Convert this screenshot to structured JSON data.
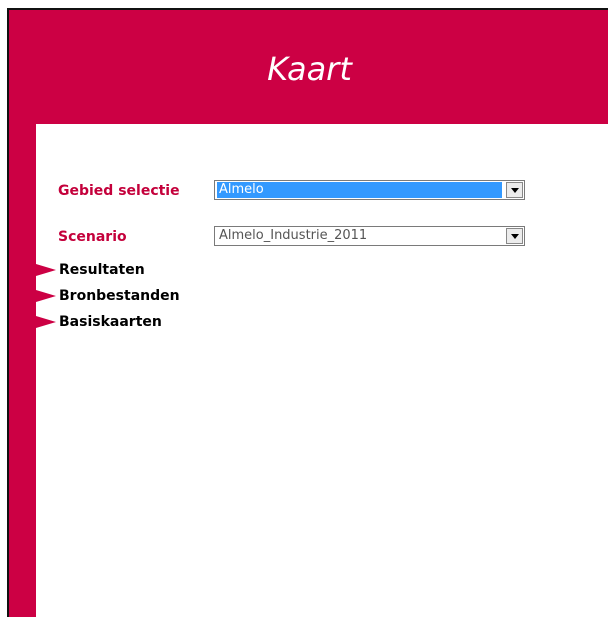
{
  "header": {
    "title": "Kaart"
  },
  "form": {
    "gebied": {
      "label": "Gebied selectie",
      "value": "Almelo"
    },
    "scenario": {
      "label": "Scenario",
      "value": "Almelo_Industrie_2011"
    }
  },
  "nav": {
    "items": [
      {
        "label": "Resultaten"
      },
      {
        "label": "Bronbestanden"
      },
      {
        "label": "Basiskaarten"
      }
    ]
  },
  "colors": {
    "brand": "#cc0044",
    "selection": "#3399ff"
  },
  "icons": {
    "dropdown": "chevron-down-icon",
    "nav": "triangle-right-icon"
  }
}
